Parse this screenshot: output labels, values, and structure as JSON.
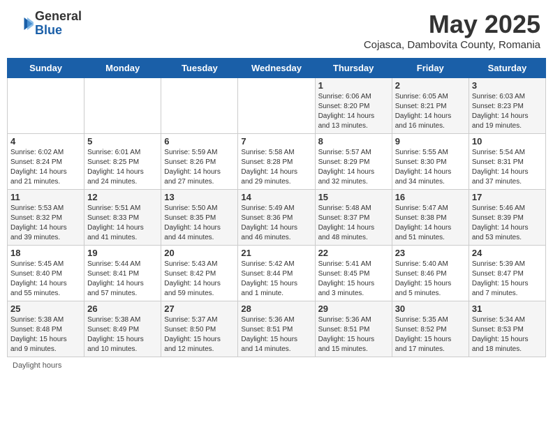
{
  "header": {
    "logo_general": "General",
    "logo_blue": "Blue",
    "month_year": "May 2025",
    "subtitle": "Cojasca, Dambovita County, Romania"
  },
  "days_of_week": [
    "Sunday",
    "Monday",
    "Tuesday",
    "Wednesday",
    "Thursday",
    "Friday",
    "Saturday"
  ],
  "weeks": [
    [
      {
        "day": "",
        "info": ""
      },
      {
        "day": "",
        "info": ""
      },
      {
        "day": "",
        "info": ""
      },
      {
        "day": "",
        "info": ""
      },
      {
        "day": "1",
        "info": "Sunrise: 6:06 AM\nSunset: 8:20 PM\nDaylight: 14 hours\nand 13 minutes."
      },
      {
        "day": "2",
        "info": "Sunrise: 6:05 AM\nSunset: 8:21 PM\nDaylight: 14 hours\nand 16 minutes."
      },
      {
        "day": "3",
        "info": "Sunrise: 6:03 AM\nSunset: 8:23 PM\nDaylight: 14 hours\nand 19 minutes."
      }
    ],
    [
      {
        "day": "4",
        "info": "Sunrise: 6:02 AM\nSunset: 8:24 PM\nDaylight: 14 hours\nand 21 minutes."
      },
      {
        "day": "5",
        "info": "Sunrise: 6:01 AM\nSunset: 8:25 PM\nDaylight: 14 hours\nand 24 minutes."
      },
      {
        "day": "6",
        "info": "Sunrise: 5:59 AM\nSunset: 8:26 PM\nDaylight: 14 hours\nand 27 minutes."
      },
      {
        "day": "7",
        "info": "Sunrise: 5:58 AM\nSunset: 8:28 PM\nDaylight: 14 hours\nand 29 minutes."
      },
      {
        "day": "8",
        "info": "Sunrise: 5:57 AM\nSunset: 8:29 PM\nDaylight: 14 hours\nand 32 minutes."
      },
      {
        "day": "9",
        "info": "Sunrise: 5:55 AM\nSunset: 8:30 PM\nDaylight: 14 hours\nand 34 minutes."
      },
      {
        "day": "10",
        "info": "Sunrise: 5:54 AM\nSunset: 8:31 PM\nDaylight: 14 hours\nand 37 minutes."
      }
    ],
    [
      {
        "day": "11",
        "info": "Sunrise: 5:53 AM\nSunset: 8:32 PM\nDaylight: 14 hours\nand 39 minutes."
      },
      {
        "day": "12",
        "info": "Sunrise: 5:51 AM\nSunset: 8:33 PM\nDaylight: 14 hours\nand 41 minutes."
      },
      {
        "day": "13",
        "info": "Sunrise: 5:50 AM\nSunset: 8:35 PM\nDaylight: 14 hours\nand 44 minutes."
      },
      {
        "day": "14",
        "info": "Sunrise: 5:49 AM\nSunset: 8:36 PM\nDaylight: 14 hours\nand 46 minutes."
      },
      {
        "day": "15",
        "info": "Sunrise: 5:48 AM\nSunset: 8:37 PM\nDaylight: 14 hours\nand 48 minutes."
      },
      {
        "day": "16",
        "info": "Sunrise: 5:47 AM\nSunset: 8:38 PM\nDaylight: 14 hours\nand 51 minutes."
      },
      {
        "day": "17",
        "info": "Sunrise: 5:46 AM\nSunset: 8:39 PM\nDaylight: 14 hours\nand 53 minutes."
      }
    ],
    [
      {
        "day": "18",
        "info": "Sunrise: 5:45 AM\nSunset: 8:40 PM\nDaylight: 14 hours\nand 55 minutes."
      },
      {
        "day": "19",
        "info": "Sunrise: 5:44 AM\nSunset: 8:41 PM\nDaylight: 14 hours\nand 57 minutes."
      },
      {
        "day": "20",
        "info": "Sunrise: 5:43 AM\nSunset: 8:42 PM\nDaylight: 14 hours\nand 59 minutes."
      },
      {
        "day": "21",
        "info": "Sunrise: 5:42 AM\nSunset: 8:44 PM\nDaylight: 15 hours\nand 1 minute."
      },
      {
        "day": "22",
        "info": "Sunrise: 5:41 AM\nSunset: 8:45 PM\nDaylight: 15 hours\nand 3 minutes."
      },
      {
        "day": "23",
        "info": "Sunrise: 5:40 AM\nSunset: 8:46 PM\nDaylight: 15 hours\nand 5 minutes."
      },
      {
        "day": "24",
        "info": "Sunrise: 5:39 AM\nSunset: 8:47 PM\nDaylight: 15 hours\nand 7 minutes."
      }
    ],
    [
      {
        "day": "25",
        "info": "Sunrise: 5:38 AM\nSunset: 8:48 PM\nDaylight: 15 hours\nand 9 minutes."
      },
      {
        "day": "26",
        "info": "Sunrise: 5:38 AM\nSunset: 8:49 PM\nDaylight: 15 hours\nand 10 minutes."
      },
      {
        "day": "27",
        "info": "Sunrise: 5:37 AM\nSunset: 8:50 PM\nDaylight: 15 hours\nand 12 minutes."
      },
      {
        "day": "28",
        "info": "Sunrise: 5:36 AM\nSunset: 8:51 PM\nDaylight: 15 hours\nand 14 minutes."
      },
      {
        "day": "29",
        "info": "Sunrise: 5:36 AM\nSunset: 8:51 PM\nDaylight: 15 hours\nand 15 minutes."
      },
      {
        "day": "30",
        "info": "Sunrise: 5:35 AM\nSunset: 8:52 PM\nDaylight: 15 hours\nand 17 minutes."
      },
      {
        "day": "31",
        "info": "Sunrise: 5:34 AM\nSunset: 8:53 PM\nDaylight: 15 hours\nand 18 minutes."
      }
    ]
  ],
  "footer": {
    "daylight_hours": "Daylight hours"
  }
}
